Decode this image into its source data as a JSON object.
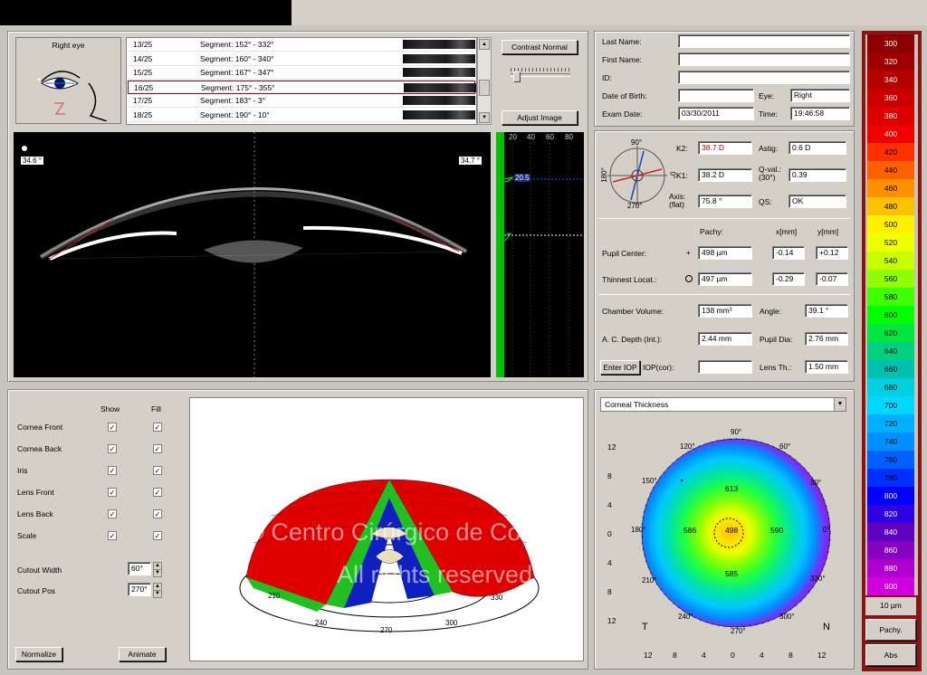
{
  "header": {},
  "eye_icon": {
    "label": "Right eye"
  },
  "segments": [
    {
      "index": "13/25",
      "label": "Segment: 152° - 332°"
    },
    {
      "index": "14/25",
      "label": "Segment: 160° - 340°"
    },
    {
      "index": "15/25",
      "label": "Segment: 167° - 347°"
    },
    {
      "index": "16/25",
      "label": "Segment: 175° - 355°"
    },
    {
      "index": "17/25",
      "label": "Segment: 183° - 3°"
    },
    {
      "index": "18/25",
      "label": "Segment: 190° - 10°"
    }
  ],
  "selected_segment": 3,
  "controls": {
    "contrast_label": "Contrast Normal",
    "adjust_label": "Adjust Image"
  },
  "scheimpflug": {
    "left_angle": "34.6 °",
    "right_angle": "34.7 °"
  },
  "density": {
    "ticks": [
      "20",
      "40",
      "60",
      "80"
    ],
    "value": "20.5"
  },
  "patient": {
    "last_name_label": "Last Name:",
    "first_name_label": "First Name:",
    "id_label": "ID:",
    "dob_label": "Date of Birth:",
    "eye_label": "Eye:",
    "eye_value": "Right",
    "exam_label": "Exam Date:",
    "exam_value": "03/30/2011",
    "time_label": "Time:",
    "time_value": "19:46:58"
  },
  "kerato": {
    "compass": {
      "top": "90°",
      "left": "180°",
      "right": "0°",
      "bottom": "270°"
    },
    "k2_label": "K2:",
    "k2": "38.7 D",
    "astig_label": "Astig:",
    "astig": "0.6 D",
    "k1_label": "K1:",
    "k1": "38.2 D",
    "qval_label": "Q-val.: (30°)",
    "qval": "0.39",
    "axis_label": "Axis: (flat)",
    "axis": "75.8 °",
    "qs_label": "QS:",
    "qs": "OK",
    "pachy_header": "Pachy:",
    "x_header": "x[mm]",
    "y_header": "y[mm]",
    "pupil_label": "Pupil Center:",
    "pupil_pachy": "498 µm",
    "pupil_x": "-0.14",
    "pupil_y": "+0.12",
    "thin_label": "Thinnest Locat.:",
    "thin_pachy": "497 µm",
    "thin_x": "-0.29",
    "thin_y": "-0.07",
    "chamber_label": "Chamber Volume:",
    "chamber": "138 mm³",
    "angle_label": "Angle:",
    "angle": "39.1 °",
    "acd_label": "A. C. Depth (Int.):",
    "acd": "2.44 mm",
    "pupil_dia_label": "Pupil Dia:",
    "pupil_dia": "2.76 mm",
    "enter_iop": "Enter IOP",
    "iop_label": "IOP(cor):",
    "iop": "",
    "lens_label": "Lens Th.:",
    "lens": "1.50 mm"
  },
  "layers": {
    "show_header": "Show",
    "fill_header": "Fill",
    "items": [
      "Cornea Front",
      "Cornea Back",
      "Iris",
      "Lens Front",
      "Lens Back",
      "Scale"
    ],
    "cutout_width_label": "Cutout Width",
    "cutout_width": "60°",
    "cutout_pos_label": "Cutout Pos",
    "cutout_pos": "270°",
    "normalize": "Normalize",
    "animate": "Animate"
  },
  "model3d": {
    "angles": [
      "210",
      "240",
      "270",
      "300",
      "330"
    ]
  },
  "watermark": {
    "line1": "© Centro Cirúrgico de Coimbra",
    "line2": "All rights reserved"
  },
  "map": {
    "dropdown": "Corneal Thickness",
    "angles": {
      "a90": "90°",
      "a60": "60°",
      "a30": "30°",
      "a0": "0°",
      "a330": "330°",
      "a300": "300°",
      "a270": "270°",
      "a240": "240°",
      "a210": "210°",
      "a180": "180°",
      "a150": "150°",
      "a120": "120°"
    },
    "yticks": [
      "12",
      "8",
      "4",
      "0",
      "4",
      "8",
      "12"
    ],
    "xticks": [
      "12",
      "8",
      "4",
      "0",
      "4",
      "8",
      "12"
    ],
    "values": {
      "center": "498",
      "top": "613",
      "bottom": "585",
      "left": "586",
      "right": "590"
    },
    "t_label": "T",
    "n_label": "N"
  },
  "color_scale": {
    "values": [
      "300",
      "320",
      "340",
      "360",
      "380",
      "400",
      "420",
      "440",
      "460",
      "480",
      "500",
      "520",
      "540",
      "560",
      "580",
      "600",
      "620",
      "640",
      "660",
      "680",
      "700",
      "720",
      "740",
      "760",
      "780",
      "800",
      "820",
      "840",
      "860",
      "880",
      "900"
    ],
    "colors": [
      "#8b0000",
      "#a00000",
      "#b40000",
      "#c80000",
      "#dc0000",
      "#f00000",
      "#ff3000",
      "#ff6000",
      "#ff9000",
      "#ffc000",
      "#fff000",
      "#f0ff00",
      "#c8ff00",
      "#90ff00",
      "#40ff00",
      "#00ff00",
      "#00e840",
      "#00d080",
      "#00c0b0",
      "#00d0e0",
      "#00d8ff",
      "#00b0ff",
      "#0090ff",
      "#0060ff",
      "#0030ff",
      "#0000ff",
      "#3000e0",
      "#6000c0",
      "#8800c0",
      "#b000d0",
      "#d000e0"
    ],
    "step": "10 µm",
    "pachy_btn": "Pachy.",
    "abs_btn": "Abs"
  }
}
